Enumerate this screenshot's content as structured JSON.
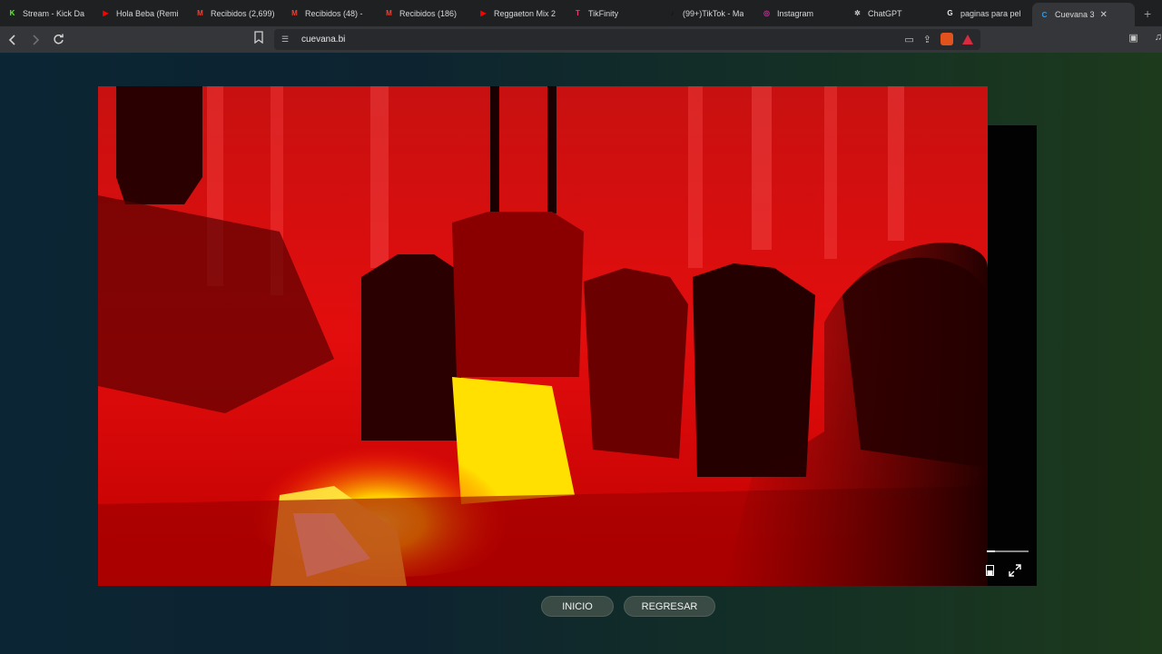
{
  "browser": {
    "tabs": [
      {
        "title": "Stream - Kick Da",
        "icon": "kick-icon",
        "color": "#53fc18",
        "glyph": "K"
      },
      {
        "title": "Hola Beba (Remi",
        "icon": "youtube-icon",
        "color": "#ff0000",
        "glyph": "▶"
      },
      {
        "title": "Recibidos (2,699)",
        "icon": "gmail-icon",
        "color": "#ea4335",
        "glyph": "M"
      },
      {
        "title": "Recibidos (48) -",
        "icon": "gmail-icon",
        "color": "#ea4335",
        "glyph": "M"
      },
      {
        "title": "Recibidos (186)",
        "icon": "gmail-icon",
        "color": "#ea4335",
        "glyph": "M"
      },
      {
        "title": "Reggaeton Mix 2",
        "icon": "youtube-icon",
        "color": "#ff0000",
        "glyph": "▶"
      },
      {
        "title": "TikFinity",
        "icon": "tikfinity-icon",
        "color": "#e43b6f",
        "glyph": "T"
      },
      {
        "title": "(99+)TikTok - Ma",
        "icon": "tiktok-icon",
        "color": "#111111",
        "glyph": "♪"
      },
      {
        "title": "Instagram",
        "icon": "instagram-icon",
        "color": "#d6249f",
        "glyph": "◎"
      },
      {
        "title": "ChatGPT",
        "icon": "chatgpt-icon",
        "color": "#cfcfcf",
        "glyph": "✲"
      },
      {
        "title": "paginas para pel",
        "icon": "google-icon",
        "color": "#e8e8e8",
        "glyph": "G"
      },
      {
        "title": "Cuevana 3",
        "icon": "cuevana-icon",
        "color": "#2e9be6",
        "glyph": "C",
        "active": true
      }
    ],
    "new_tab": "+",
    "close_tab": "✕",
    "url": "cuevana.bi"
  },
  "player": {
    "progress": 0.2
  },
  "buttons": {
    "inicio": "INICIO",
    "regresar": "REGRESAR"
  }
}
